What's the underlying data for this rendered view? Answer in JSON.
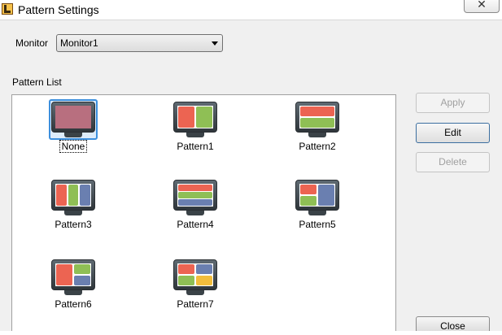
{
  "window": {
    "title": "Pattern Settings",
    "close_glyph": "✕"
  },
  "monitor": {
    "label": "Monitor",
    "selected": "Monitor1"
  },
  "pattern_list": {
    "label": "Pattern List",
    "items": [
      {
        "id": "none",
        "label": "None",
        "selected": true
      },
      {
        "id": "pattern1",
        "label": "Pattern1",
        "selected": false
      },
      {
        "id": "pattern2",
        "label": "Pattern2",
        "selected": false
      },
      {
        "id": "pattern3",
        "label": "Pattern3",
        "selected": false
      },
      {
        "id": "pattern4",
        "label": "Pattern4",
        "selected": false
      },
      {
        "id": "pattern5",
        "label": "Pattern5",
        "selected": false
      },
      {
        "id": "pattern6",
        "label": "Pattern6",
        "selected": false
      },
      {
        "id": "pattern7",
        "label": "Pattern7",
        "selected": false
      }
    ]
  },
  "buttons": {
    "apply": {
      "label": "Apply",
      "enabled": false
    },
    "edit": {
      "label": "Edit",
      "enabled": true
    },
    "delete": {
      "label": "Delete",
      "enabled": false
    },
    "close": {
      "label": "Close",
      "enabled": true
    }
  },
  "colors": {
    "red": "#ec6452",
    "green": "#8fbf55",
    "blue": "#6a7fb0",
    "yellow": "#f2bd3c",
    "none_fill": "#b86f7f",
    "selection": "#3c8fdd"
  }
}
